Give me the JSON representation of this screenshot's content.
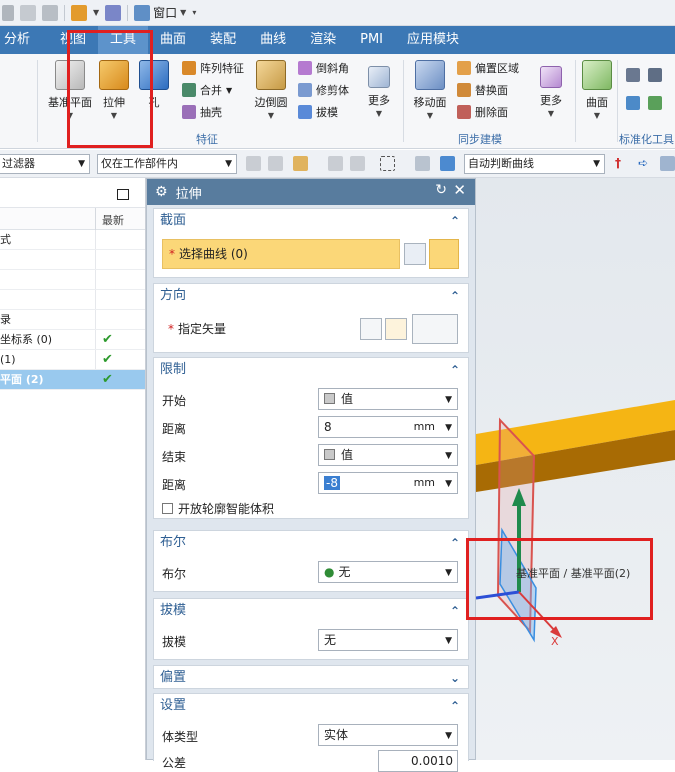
{
  "quick_access": {
    "window_label": "窗口"
  },
  "menu": {
    "tabs": [
      "分析",
      "视图",
      "工具",
      "曲面",
      "装配",
      "曲线",
      "渲染",
      "PMI",
      "应用模块"
    ]
  },
  "ribbon": {
    "datum_plane": "基准平面",
    "extrude": "拉伸",
    "hole": "孔",
    "pattern_feature": "阵列特征",
    "unite": "合并",
    "shell": "抽壳",
    "edge_blend": "边倒圆",
    "chamfer": "倒斜角",
    "trim_body": "修剪体",
    "draft": "拔模",
    "more_1": "更多",
    "move_face": "移动面",
    "offset_region": "偏置区域",
    "replace_face": "替换面",
    "delete_face": "删除面",
    "more_2": "更多",
    "surface": "曲面",
    "feature_group": "特征",
    "sync_group": "同步建模",
    "standard_group": "标准化工具"
  },
  "filterbar": {
    "filter": "过滤器",
    "scope": "仅在工作部件内",
    "curve_rule": "自动判断曲线"
  },
  "navigator": {
    "column_latest": "最新",
    "rows": [
      {
        "label": "式",
        "check": ""
      },
      {
        "label": "",
        "check": ""
      },
      {
        "label": "",
        "check": ""
      },
      {
        "label": "",
        "check": ""
      },
      {
        "label": "录",
        "check": ""
      },
      {
        "label": "坐标系 (0)",
        "check": "✔"
      },
      {
        "label": "(1)",
        "check": "✔"
      },
      {
        "label": "平面 (2)",
        "check": "✔"
      }
    ]
  },
  "dialog": {
    "title": "拉伸",
    "section": {
      "header": "截面",
      "select_curve": "选择曲线 (0)"
    },
    "direction": {
      "header": "方向",
      "specify_vector": "指定矢量"
    },
    "limits": {
      "header": "限制",
      "start_label": "开始",
      "start_value": "值",
      "start_distance_label": "距离",
      "start_distance": "8",
      "end_label": "结束",
      "end_value": "值",
      "end_distance_label": "距离",
      "end_distance": "-8",
      "unit": "mm",
      "open_profile": "开放轮廓智能体积"
    },
    "boolean": {
      "header": "布尔",
      "label": "布尔",
      "value": "无"
    },
    "draft": {
      "header": "拔模",
      "label": "拔模",
      "value": "无"
    },
    "offset": {
      "header": "偏置"
    },
    "settings": {
      "header": "设置",
      "body_type_label": "体类型",
      "body_type": "实体",
      "tolerance_label": "公差",
      "tolerance": "0.0010"
    }
  },
  "viewport": {
    "tooltip": "基准平面 / 基准平面(2)",
    "axis_x": "X"
  }
}
